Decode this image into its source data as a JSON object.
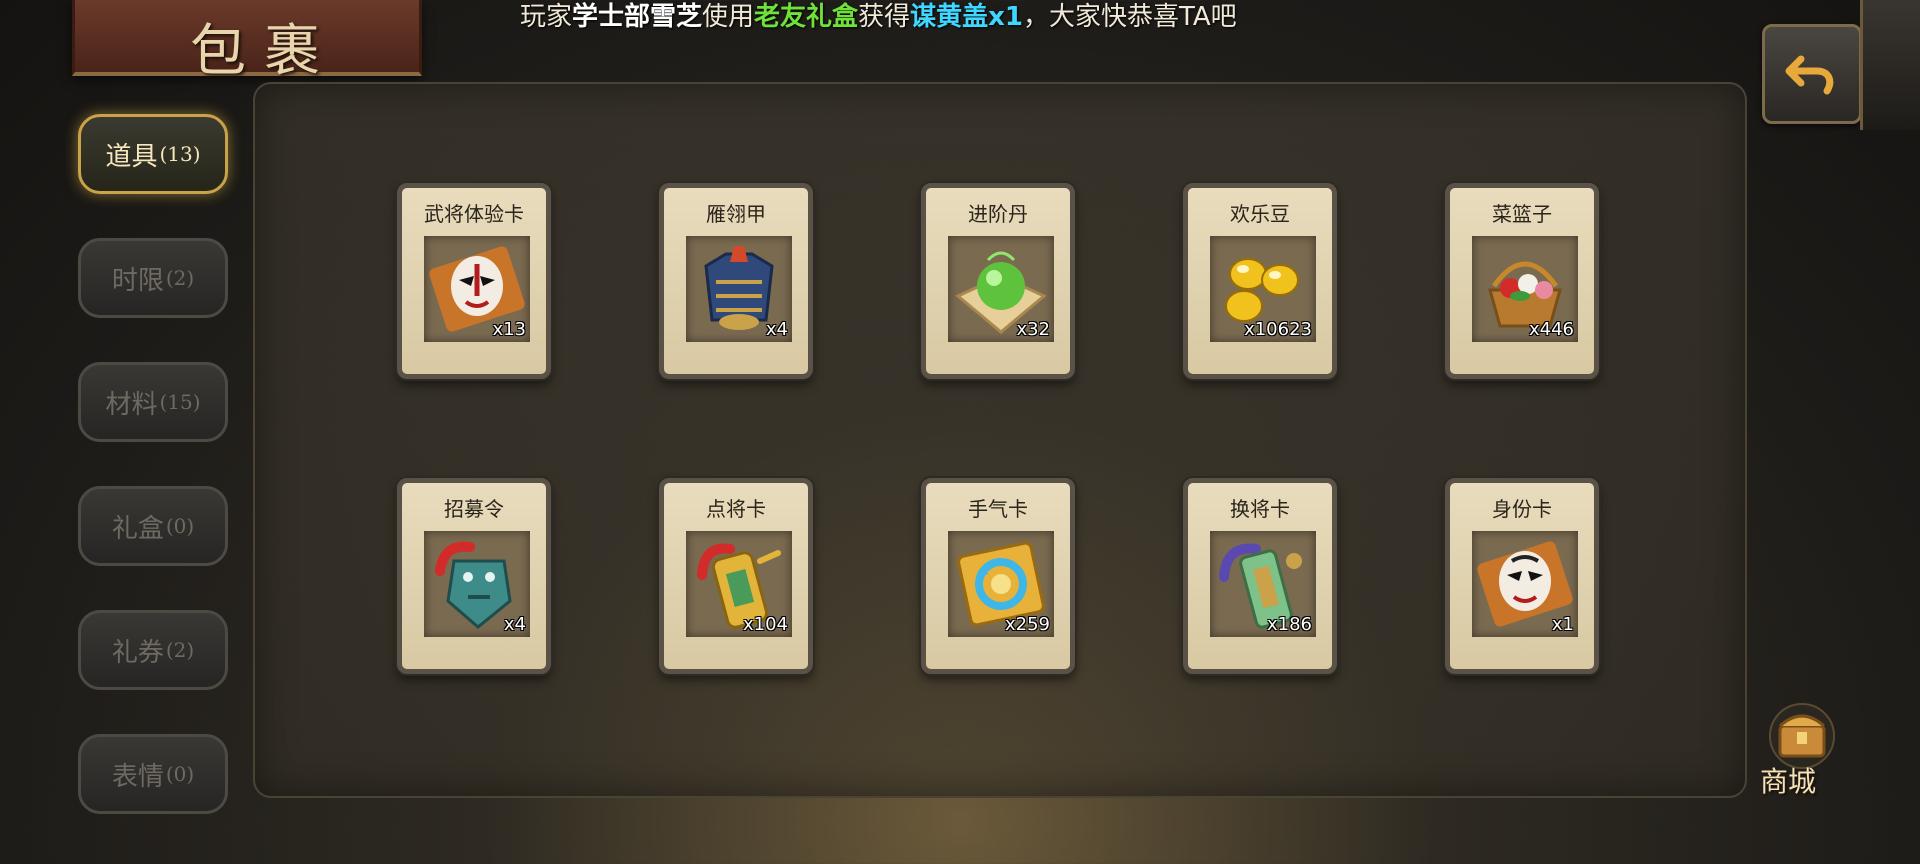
{
  "window": {
    "title": "包裹"
  },
  "broadcast": {
    "prefix": "玩家",
    "player": "学士部雪芝",
    "mid1": "使用",
    "item_used": "老友礼盒",
    "mid2": "获得",
    "reward": "谋黄盖x1",
    "suffix": "，大家快恭喜TA吧"
  },
  "back_button": {
    "icon": "back-arrow-icon"
  },
  "tabs": [
    {
      "label": "道具",
      "count": "(13)",
      "active": true
    },
    {
      "label": "时限",
      "count": "(2)",
      "active": false
    },
    {
      "label": "材料",
      "count": "(15)",
      "active": false
    },
    {
      "label": "礼盒",
      "count": "(0)",
      "active": false
    },
    {
      "label": "礼券",
      "count": "(2)",
      "active": false
    },
    {
      "label": "表情",
      "count": "(0)",
      "active": false
    }
  ],
  "items": [
    {
      "name": "武将体验卡",
      "qty": "x13",
      "icon": "opera-mask-card-icon"
    },
    {
      "name": "雁翎甲",
      "qty": "x4",
      "icon": "armor-icon"
    },
    {
      "name": "进阶丹",
      "qty": "x32",
      "icon": "green-pill-icon"
    },
    {
      "name": "欢乐豆",
      "qty": "x10623",
      "icon": "gold-beans-icon"
    },
    {
      "name": "菜篮子",
      "qty": "x446",
      "icon": "flower-basket-icon"
    },
    {
      "name": "招募令",
      "qty": "x4",
      "icon": "recruit-token-icon"
    },
    {
      "name": "点将卡",
      "qty": "x104",
      "icon": "general-token-icon"
    },
    {
      "name": "手气卡",
      "qty": "x259",
      "icon": "luck-card-icon"
    },
    {
      "name": "换将卡",
      "qty": "x186",
      "icon": "swap-token-icon"
    },
    {
      "name": "身份卡",
      "qty": "x1",
      "icon": "identity-mask-card-icon"
    }
  ],
  "shop": {
    "label": "商城"
  },
  "colors": {
    "accent_gold": "#c9a24a",
    "highlight_green": "#6fe23a",
    "highlight_cyan": "#3fd6ff"
  }
}
